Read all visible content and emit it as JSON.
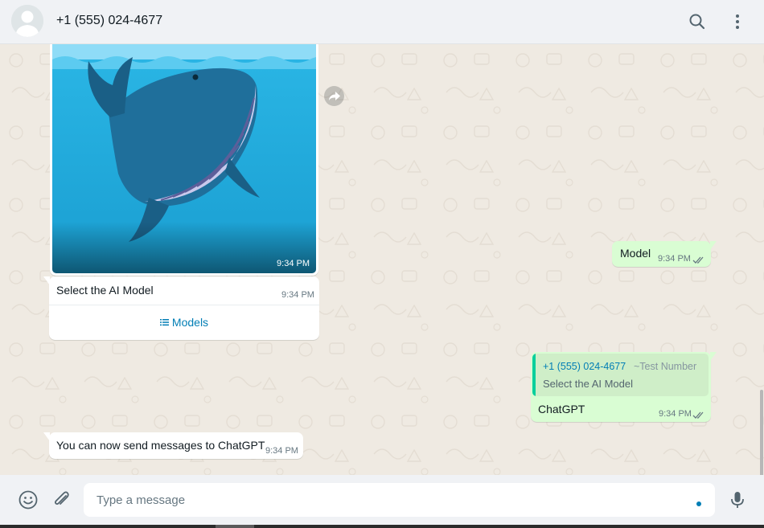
{
  "header": {
    "contact_name": "+1 (555) 024-4677",
    "icons": [
      "avatar-placeholder",
      "search-icon",
      "menu-dots-icon"
    ]
  },
  "messages": [
    {
      "type": "image",
      "direction": "incoming",
      "time": "9:34 PM",
      "image": "whale-illustration"
    },
    {
      "type": "text",
      "direction": "outgoing",
      "text": "Model",
      "time": "9:34 PM",
      "status": "read"
    },
    {
      "type": "list",
      "direction": "incoming",
      "text": "Select the AI Model",
      "time": "9:34 PM",
      "button_label": "Models"
    },
    {
      "type": "reply",
      "direction": "outgoing",
      "quoted_sender": "+1 (555) 024-4677",
      "quoted_pushname": "~Test Number",
      "quoted_text": "Select the AI Model",
      "text": "ChatGPT",
      "time": "9:34 PM",
      "status": "read"
    },
    {
      "type": "text",
      "direction": "incoming",
      "text": "You can now send messages to ChatGPT",
      "time": "9:34 PM"
    }
  ],
  "composer": {
    "placeholder": "Type a message",
    "icons": [
      "emoji-icon",
      "attach-icon",
      "mic-icon"
    ]
  },
  "colors": {
    "outgoing_bubble": "#d9fdd3",
    "incoming_bubble": "#ffffff",
    "accent": "#027eb5",
    "quote_bar": "#06cf9c",
    "read_ticks": "#667781"
  }
}
